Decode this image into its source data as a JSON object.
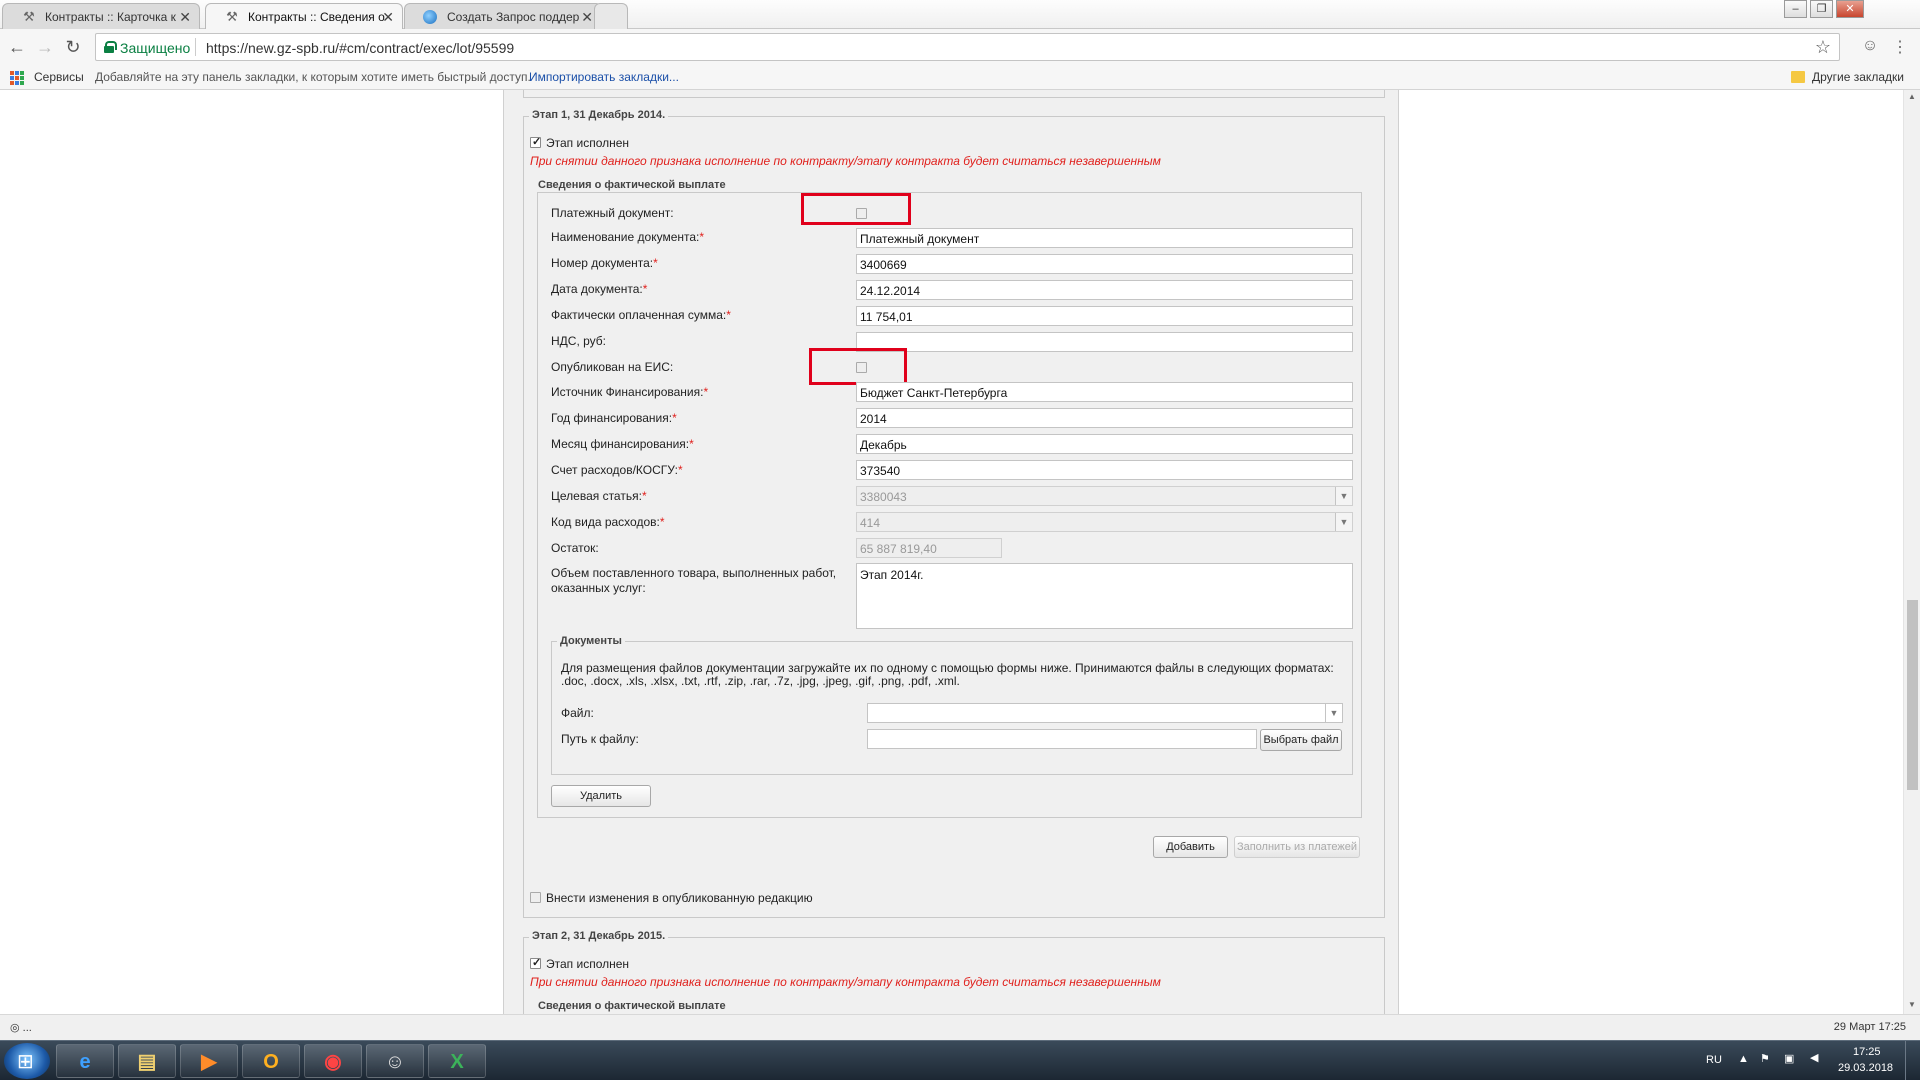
{
  "browser": {
    "tabs": [
      {
        "label": "Контракты :: Карточка к",
        "active": false,
        "icon": "tools-icon"
      },
      {
        "label": "Контракты :: Сведения о",
        "active": true,
        "icon": "tools-icon"
      },
      {
        "label": "Создать Запрос поддер",
        "active": false,
        "icon": "globe-icon"
      }
    ],
    "tab_close": "✕",
    "secure_label": "Защищено",
    "url": "https://new.gz-spb.ru/#cm/contract/exec/lot/95599",
    "bookmarks": {
      "apps_label": "Сервисы",
      "hint": "Добавляйте на эту панель закладки, к которым хотите иметь быстрый доступ.",
      "import_link": "Импортировать закладки...",
      "other": "Другие закладки"
    }
  },
  "stage1": {
    "legend": "Этап 1, 31 Декабрь 2014.",
    "done_label": "Этап исполнен",
    "done_checked": true,
    "warning": "При снятии данного признака исполнение по контракту/этапу контракта будет считаться незавершенным",
    "payment_legend": "Сведения о фактической выплате",
    "fields": {
      "payment_doc_label": "Платежный документ:",
      "doc_name_label": "Наименование документа:",
      "doc_name_value": "Платежный документ",
      "doc_number_label": "Номер документа:",
      "doc_number_value": "3400669",
      "doc_date_label": "Дата документа:",
      "doc_date_value": "24.12.2014",
      "paid_sum_label": "Фактически оплаченная сумма:",
      "paid_sum_value": "11 754,01",
      "vat_label": "НДС, руб:",
      "vat_value": "",
      "published_label": "Опубликован на ЕИС:",
      "source_label": "Источник Финансирования:",
      "source_value": "Бюджет Санкт-Петербурга",
      "year_label": "Год финансирования:",
      "year_value": "2014",
      "month_label": "Месяц финансирования:",
      "month_value": "Декабрь",
      "account_label": "Счет расходов/КОСГУ:",
      "account_value": "373540",
      "target_label": "Целевая статья:",
      "target_value": "3380043",
      "expense_code_label": "Код вида расходов:",
      "expense_code_value": "414",
      "balance_label": "Остаток:",
      "balance_value": "65 887 819,40",
      "volume_label_line1": "Объем поставленного товара, выполненных работ,",
      "volume_label_line2": "оказанных услуг:",
      "volume_value": "Этап 2014г."
    },
    "required_mark": "*",
    "documents": {
      "legend": "Документы",
      "hint_line1": "Для размещения файлов документации загружайте их по одному с помощью формы ниже. Принимаются файлы в следующих форматах:",
      "hint_line2": ".doc, .docx, .xls, .xlsx, .txt, .rtf, .zip, .rar, .7z, .jpg, .jpeg, .gif, .png, .pdf, .xml.",
      "file_label": "Файл:",
      "file_value": "",
      "path_label": "Путь к файлу:",
      "path_value": "",
      "choose_button": "Выбрать файл"
    },
    "delete_button": "Удалить",
    "add_button": "Добавить",
    "fill_button": "Заполнить из платежей",
    "edit_published_label": "Внести изменения в опубликованную редакцию"
  },
  "stage2": {
    "legend": "Этап 2, 31 Декабрь 2015.",
    "done_label": "Этап исполнен",
    "warning": "При снятии данного признака исполнение по контракту/этапу контракта будет считаться незавершенным",
    "payment_legend": "Сведения о фактической выплате"
  },
  "statusbar": {
    "left": "◎ ...",
    "right": "29 Март 17:25"
  },
  "taskbar": {
    "lang": "RU",
    "time": "17:25",
    "date": "29.03.2018"
  },
  "colors": {
    "highlight": "#e0001b",
    "required": "#e0201c",
    "secure": "#0b8043"
  }
}
